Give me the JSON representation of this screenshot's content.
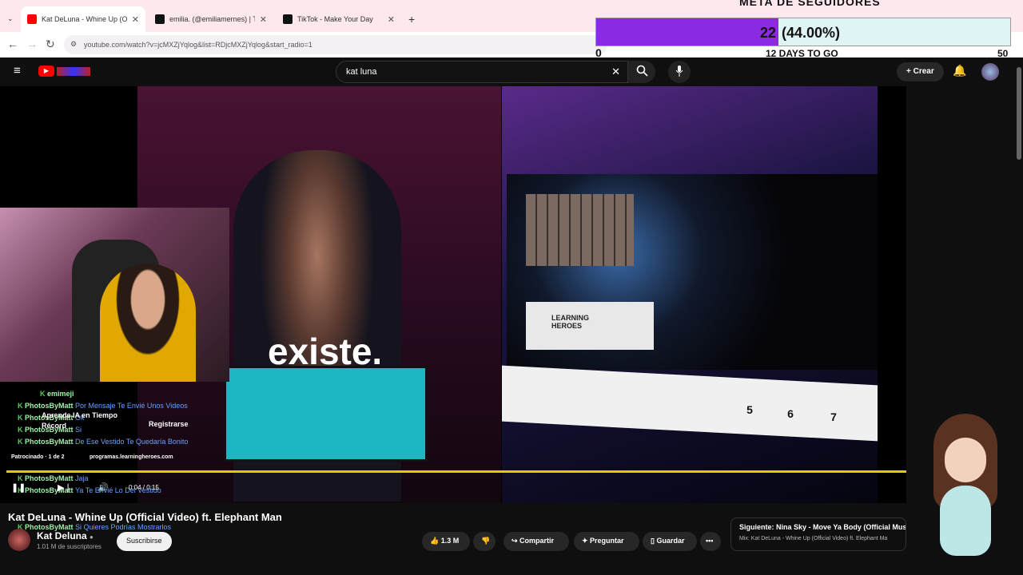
{
  "tabs": [
    {
      "label": "Kat DeLuna - Whine Up (Of",
      "fav": "#ff0000"
    },
    {
      "label": "emilia. (@emiliamernes) | TikTo",
      "fav": "#111111"
    },
    {
      "label": "TikTok - Make Your Day",
      "fav": "#111111"
    }
  ],
  "address": {
    "url": "youtube.com/watch?v=jcMXZjYqlog&list=RDjcMXZjYqlog&start_radio=1"
  },
  "goal": {
    "title": "META DE SEGUIDORES",
    "count": "22",
    "percent": "(44.00%)",
    "fraction": 0.44,
    "min": "0",
    "days": "12 DAYS TO GO",
    "max": "50"
  },
  "search": {
    "query": "kat luna"
  },
  "header": {
    "create": "Crear"
  },
  "video": {
    "caption": "existe.",
    "steps": [
      "5",
      "6",
      "7"
    ],
    "brand": "LEARNING HEROES",
    "time": "0:04 / 0:15"
  },
  "overlay": {
    "sponsor": "Patrocinado · 1 de 2",
    "ad_url": "programas.learningheroes.com",
    "ad_title": "Aprende IA en Tiempo Récord",
    "ad_cta": "Registrarse"
  },
  "chat": [
    {
      "u": "emimeji",
      "m": ""
    },
    {
      "u": "PhotosByMatt",
      "m": "Por Mensaje Te Envié Unos Videos"
    },
    {
      "u": "PhotosByMatt",
      "m": "Ok"
    },
    {
      "u": "PhotosByMatt",
      "m": "Si"
    },
    {
      "u": "PhotosByMatt",
      "m": "De Ese Vestido Te Quedaría Bonito"
    },
    {
      "u": "PhotosByMatt",
      "m": "Jaja"
    },
    {
      "u": "PhotosByMatt",
      "m": "Ya Te Envié Lo Del Vestido"
    },
    {
      "u": "PhotosByMatt",
      "m": "Si Quieres Podrías Mostrarlos"
    }
  ],
  "info": {
    "title": "Kat DeLuna - Whine Up (Official Video) ft. Elephant Man",
    "channel": "Kat Deluna",
    "subs": "1.01 M de suscriptores",
    "subscribe": "Suscribirse",
    "likes": "1.3 M",
    "share": "Compartir",
    "ask": "Preguntar",
    "save": "Guardar"
  },
  "next": {
    "label": "Siguiente: Nina Sky - Move Ya Body (Official Music",
    "mix": "Mix: Kat DeLuna - Whine Up (Official Video) ft. Elephant Ma"
  }
}
